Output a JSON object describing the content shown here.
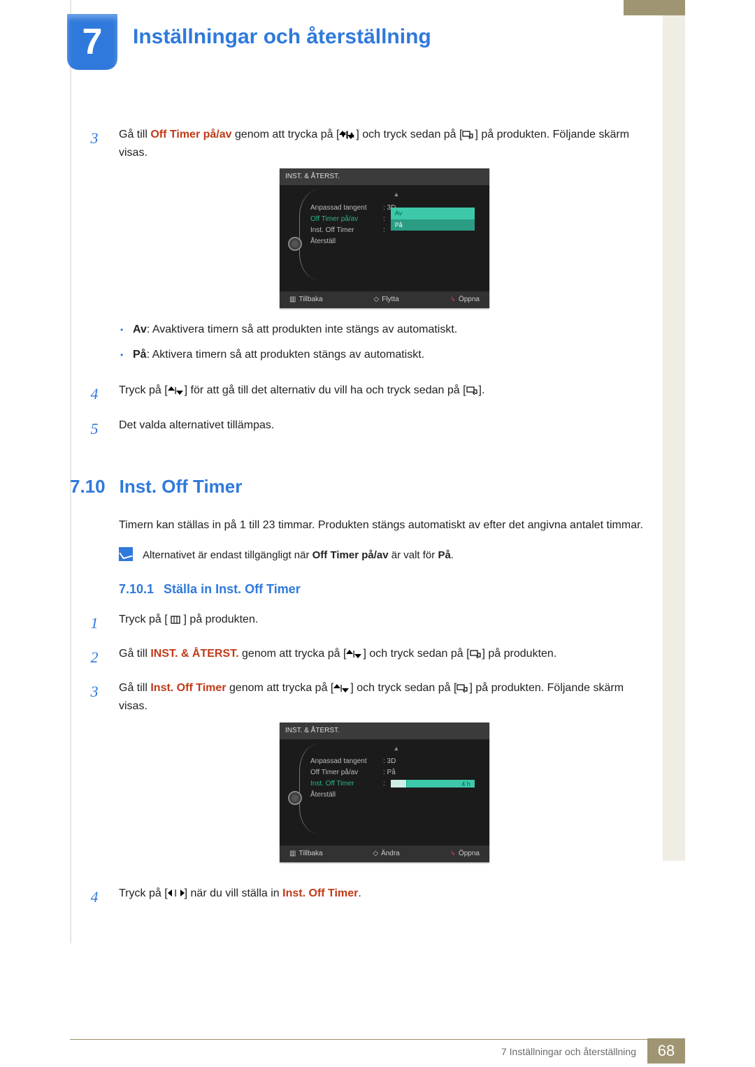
{
  "chapter": {
    "number": "7",
    "title": "Inställningar och återställning"
  },
  "stepsA": {
    "3": {
      "pre": "Gå till ",
      "bold": "Off Timer på/av",
      "mid": " genom att trycka på [",
      "mid2": "] och tryck sedan på [",
      "post": "] på produkten. Följande skärm visas."
    },
    "4": {
      "pre": "Tryck på [",
      "mid": "] för att gå till det alternativ du vill ha och tryck sedan på [",
      "post": "]."
    },
    "5": "Det valda alternativet tillämpas."
  },
  "bullets": {
    "av": {
      "b": "Av",
      "t": ": Avaktivera timern så att produkten inte stängs av automatiskt."
    },
    "pa": {
      "b": "På",
      "t": ": Aktivera timern så att produkten stängs av automatiskt."
    }
  },
  "osd1": {
    "header": "INST. & ÅTERST.",
    "rows": {
      "r1l": "Anpassad tangent",
      "r1v": ": 3D",
      "r2l": "Off Timer på/av",
      "opt_av": "Av",
      "opt_pa": "På",
      "r3l": "Inst. Off Timer",
      "r4l": "Återställ"
    },
    "footer": {
      "back": "Tillbaka",
      "move": "Flytta",
      "open": "Öppna"
    }
  },
  "section": {
    "num": "7.10",
    "title": "Inst. Off Timer"
  },
  "section_para": "Timern kan ställas in på 1 till 23 timmar. Produkten stängs automatiskt av efter det angivna antalet timmar.",
  "note": {
    "pre": "Alternativet är endast tillgängligt när ",
    "b1": "Off Timer på/av",
    "mid": " är valt för ",
    "b2": "På",
    "post": "."
  },
  "subsection": {
    "num": "7.10.1",
    "title": "Ställa in Inst. Off Timer"
  },
  "stepsB": {
    "1": {
      "pre": "Tryck på [ ",
      "post": " ] på produkten."
    },
    "2": {
      "pre": "Gå till ",
      "bold": "INST. & ÅTERST.",
      "mid": " genom att trycka på [",
      "mid2": "] och tryck sedan på [",
      "post": "] på produkten."
    },
    "3": {
      "pre": "Gå till ",
      "bold": "Inst. Off Timer",
      "mid": " genom att trycka på [",
      "mid2": "] och tryck sedan på [",
      "post": "] på produkten. Följande skärm visas."
    },
    "4": {
      "pre": "Tryck på [",
      "mid": "] när du vill ställa in ",
      "bold": "Inst. Off Timer",
      "post": "."
    }
  },
  "osd2": {
    "header": "INST. & ÅTERST.",
    "rows": {
      "r1l": "Anpassad tangent",
      "r1v": ":  3D",
      "r2l": "Off Timer på/av",
      "r2v": ":  På",
      "r3l": "Inst. Off Timer",
      "bar": "4 h",
      "r4l": "Återställ"
    },
    "footer": {
      "back": "Tillbaka",
      "move": "Ändra",
      "open": "Öppna"
    }
  },
  "footer": {
    "text": "7 Inställningar och återställning",
    "page": "68"
  }
}
